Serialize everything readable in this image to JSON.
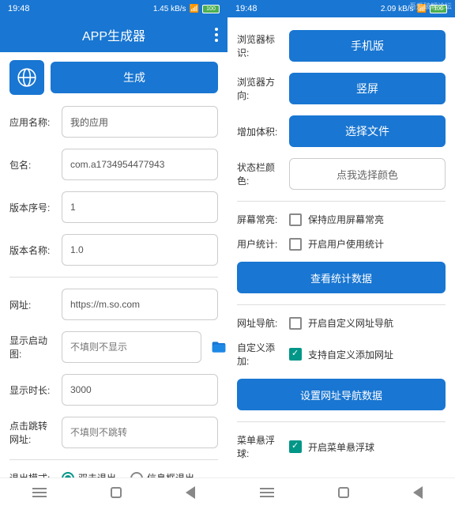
{
  "status": {
    "time": "19:48",
    "network1": "1.45 kB/s",
    "network2": "2.09 kB/s",
    "battery": "100"
  },
  "header": {
    "title": "APP生成器"
  },
  "left": {
    "generate_btn": "生成",
    "app_name_label": "应用名称:",
    "app_name_value": "我的应用",
    "package_label": "包名:",
    "package_value": "com.a1734954477943",
    "version_code_label": "版本序号:",
    "version_code_value": "1",
    "version_name_label": "版本名称:",
    "version_name_value": "1.0",
    "url_label": "网址:",
    "url_value": "https://m.so.com",
    "splash_label": "显示启动图:",
    "splash_value": "不填则不显示",
    "duration_label": "显示时长:",
    "duration_value": "3000",
    "click_jump_label": "点击跳转网址:",
    "click_jump_value": "不填则不跳转",
    "exit_mode_label": "退出模式:",
    "exit_double": "双击退出",
    "exit_dialog": "信息框退出"
  },
  "right": {
    "browser_id_label": "浏览器标识:",
    "browser_id_btn": "手机版",
    "orientation_label": "浏览器方向:",
    "orientation_btn": "竖屏",
    "volume_label": "增加体积:",
    "volume_btn": "选择文件",
    "statusbar_label": "状态栏颜色:",
    "statusbar_btn": "点我选择颜色",
    "keepscreen_label": "屏幕常亮:",
    "keepscreen_check": "保持应用屏幕常亮",
    "userstat_label": "用户统计:",
    "userstat_check": "开启用户使用统计",
    "viewstat_btn": "查看统计数据",
    "urlnav_label": "网址导航:",
    "urlnav_check": "开启自定义网址导航",
    "customadd_label": "自定义添加:",
    "customadd_check": "支持自定义添加网址",
    "setnav_btn": "设置网址导航数据",
    "menufloat_label": "菜单悬浮球:",
    "menufloat_check": "开启菜单悬浮球",
    "watermark": "吾爱破解论坛"
  }
}
